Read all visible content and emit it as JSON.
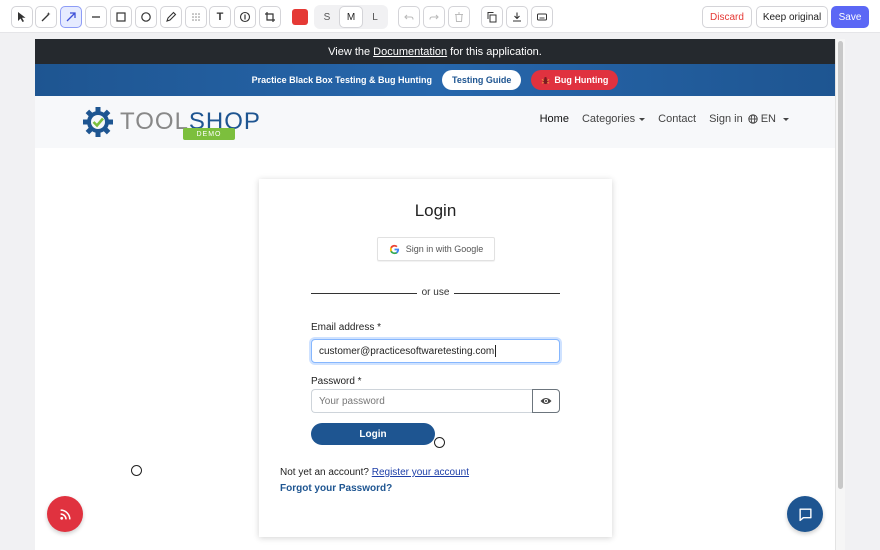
{
  "toolbar": {
    "tools": [
      {
        "name": "select",
        "icon": "pointer-icon"
      },
      {
        "name": "magic",
        "icon": "magic-wand-icon"
      },
      {
        "name": "arrow",
        "icon": "arrow-icon",
        "active": true
      },
      {
        "name": "line",
        "icon": "line-icon"
      },
      {
        "name": "rectangle",
        "icon": "rectangle-icon"
      },
      {
        "name": "ellipse",
        "icon": "ellipse-icon"
      },
      {
        "name": "pen",
        "icon": "pen-icon"
      },
      {
        "name": "blur",
        "icon": "blur-icon"
      },
      {
        "name": "text",
        "icon": "text-icon",
        "label": "T"
      },
      {
        "name": "step",
        "icon": "step-counter-icon"
      },
      {
        "name": "crop",
        "icon": "crop-icon"
      }
    ],
    "color": "#e53935",
    "sizes": [
      "S",
      "M",
      "L"
    ],
    "selected_size": "M",
    "discard_label": "Discard",
    "keep_label": "Keep original",
    "save_label": "Save"
  },
  "page": {
    "doc_bar": {
      "prefix": "View the",
      "link": "Documentation",
      "suffix": "for this application."
    },
    "promo": {
      "text": "Practice Black Box Testing & Bug Hunting",
      "guide_label": "Testing Guide",
      "bug_label": "Bug Hunting"
    },
    "nav": {
      "logo_main": "TOOL",
      "logo_highlight": "SHOP",
      "logo_badge": "DEMO",
      "home": "Home",
      "categories": "Categories",
      "contact": "Contact",
      "sign_in": "Sign in",
      "language": "EN"
    },
    "login": {
      "title": "Login",
      "google_label": "Sign in with Google",
      "divider": "or use",
      "email_label": "Email address *",
      "email_value": "customer@practicesoftwaretesting.com",
      "password_label": "Password *",
      "password_placeholder": "Your password",
      "submit_label": "Login",
      "no_account": "Not yet an account?",
      "register_link": "Register your account",
      "forgot_link": "Forgot your Password?"
    }
  },
  "colors": {
    "brand_blue": "#1e5591",
    "accent_red": "#e0323f",
    "save_purple": "#5b67f5"
  }
}
